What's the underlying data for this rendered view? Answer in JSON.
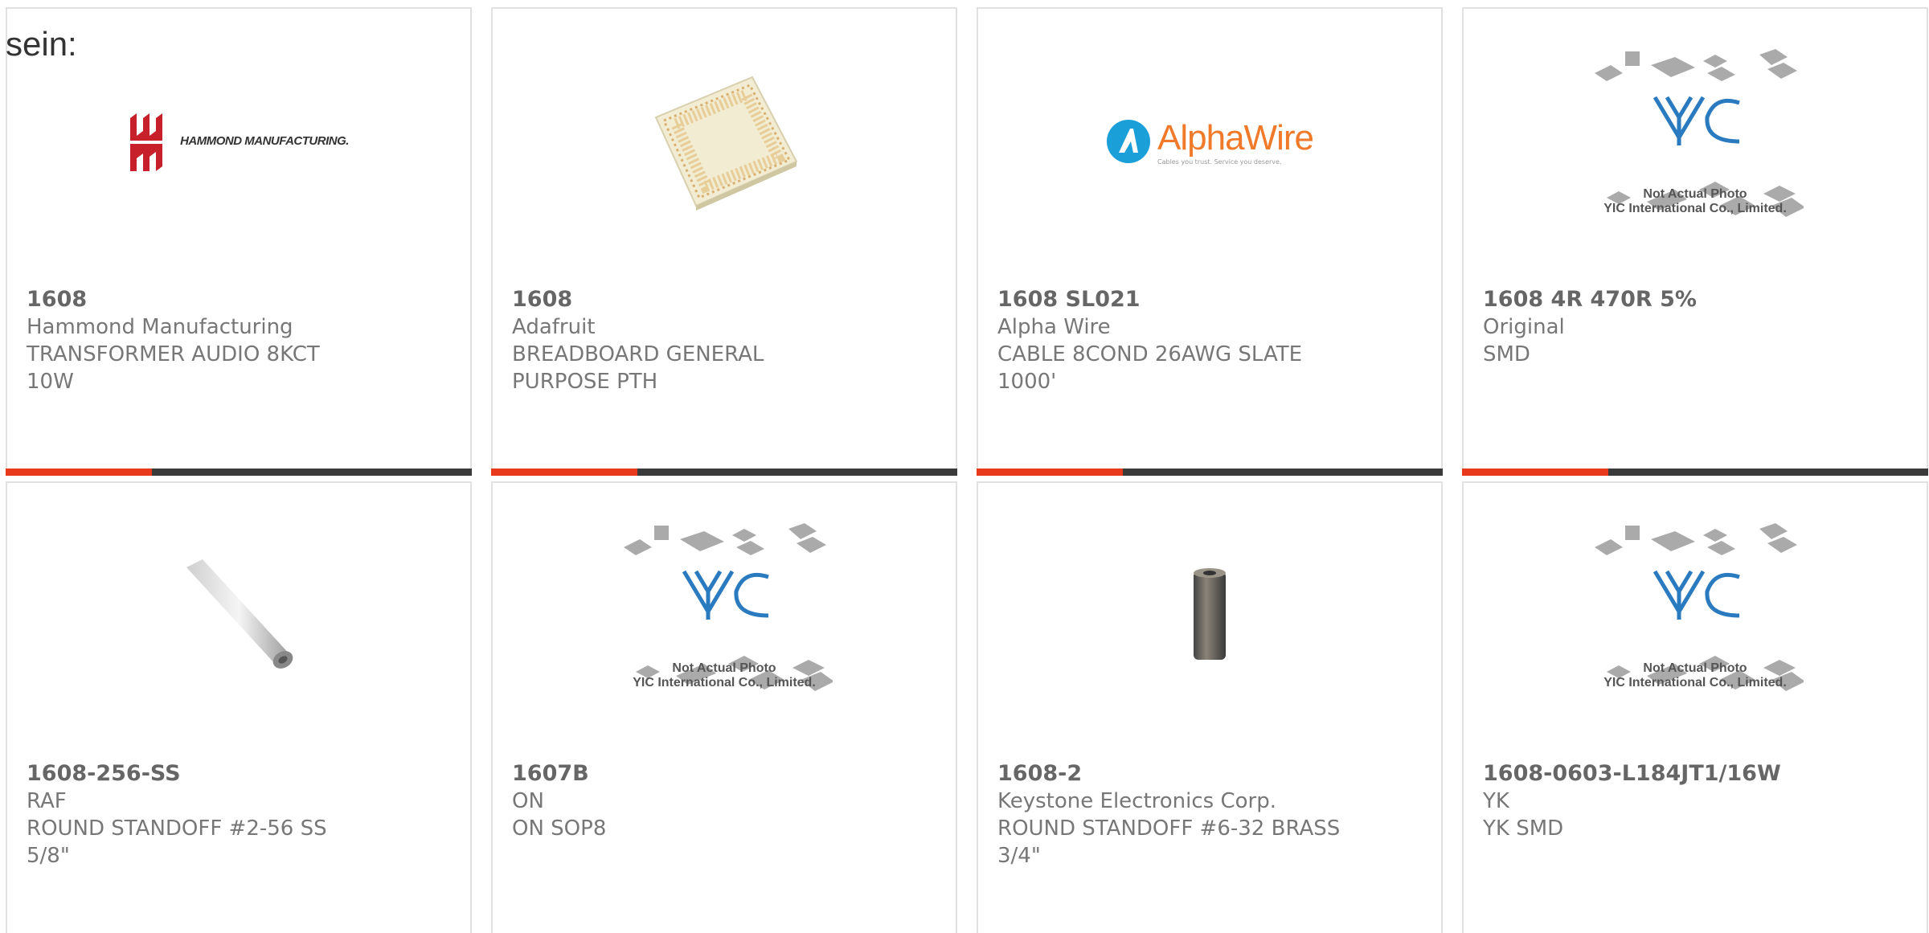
{
  "intro_text": "sein:",
  "colors": {
    "accent": "#e8391d",
    "bar": "#3a3a3a",
    "border": "#e1e1e1",
    "text": "#666666"
  },
  "products": [
    {
      "part": "1608",
      "maker": "Hammond Manufacturing",
      "desc1": "TRANSFORMER AUDIO 8KCT",
      "desc2": "10W",
      "image": "hammond-logo",
      "logo_text": "HAMMOND MANUFACTURING."
    },
    {
      "part": "1608",
      "maker": "Adafruit",
      "desc1": "BREADBOARD GENERAL",
      "desc2": "PURPOSE PTH",
      "image": "breadboard-photo"
    },
    {
      "part": "1608 SL021",
      "maker": "Alpha Wire",
      "desc1": "CABLE 8COND 26AWG SLATE",
      "desc2": "1000'",
      "image": "alphawire-logo",
      "logo_text": "AlphaWire",
      "logo_tagline": "Cables you trust. Service you deserve."
    },
    {
      "part": "1608 4R 470R 5%",
      "maker": "Original",
      "desc1": "SMD",
      "desc2": "",
      "image": "yic-placeholder"
    },
    {
      "part": "1608-256-SS",
      "maker": "RAF",
      "desc1": "ROUND STANDOFF #2-56 SS",
      "desc2": "5/8\"",
      "image": "standoff-photo"
    },
    {
      "part": "1607B",
      "maker": "ON",
      "desc1": "ON SOP8",
      "desc2": "",
      "image": "yic-placeholder"
    },
    {
      "part": "1608-2",
      "maker": "Keystone Electronics Corp.",
      "desc1": "ROUND STANDOFF #6-32 BRASS",
      "desc2": "3/4\"",
      "image": "standoff-brass-photo"
    },
    {
      "part": "1608-0603-L184JT1/16W",
      "maker": "YK",
      "desc1": "YK SMD",
      "desc2": "",
      "image": "yic-placeholder"
    }
  ],
  "yic": {
    "line1": "Not Actual Photo",
    "line2": "YIC International Co., Limited."
  }
}
